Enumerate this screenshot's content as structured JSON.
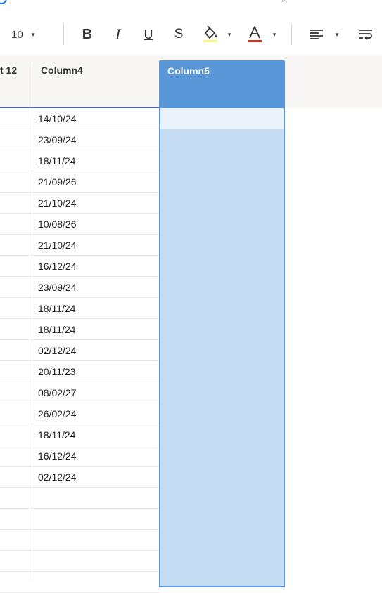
{
  "toolbar": {
    "font_size": "10",
    "caret": "▾",
    "bold_label": "B",
    "italic_label": "I",
    "underline_label": "U",
    "strike_label": "S",
    "fill_color": "#f6f37a",
    "text_color": "#d93025"
  },
  "grid": {
    "partial_header": "t 12",
    "column4_header": "Column4",
    "column5_header": "Column5",
    "column4_values": [
      "14/10/24",
      "23/09/24",
      "18/11/24",
      "21/09/26",
      "21/10/24",
      "10/08/26",
      "21/10/24",
      "16/12/24",
      "23/09/24",
      "18/11/24",
      "18/11/24",
      "02/12/24",
      "20/11/23",
      "08/02/27",
      "26/02/24",
      "18/11/24",
      "16/12/24",
      "02/12/24"
    ]
  },
  "colors": {
    "accent": "#5a97d8",
    "selection": "#c6dcf2",
    "header_bg": "#f8f7f6"
  }
}
